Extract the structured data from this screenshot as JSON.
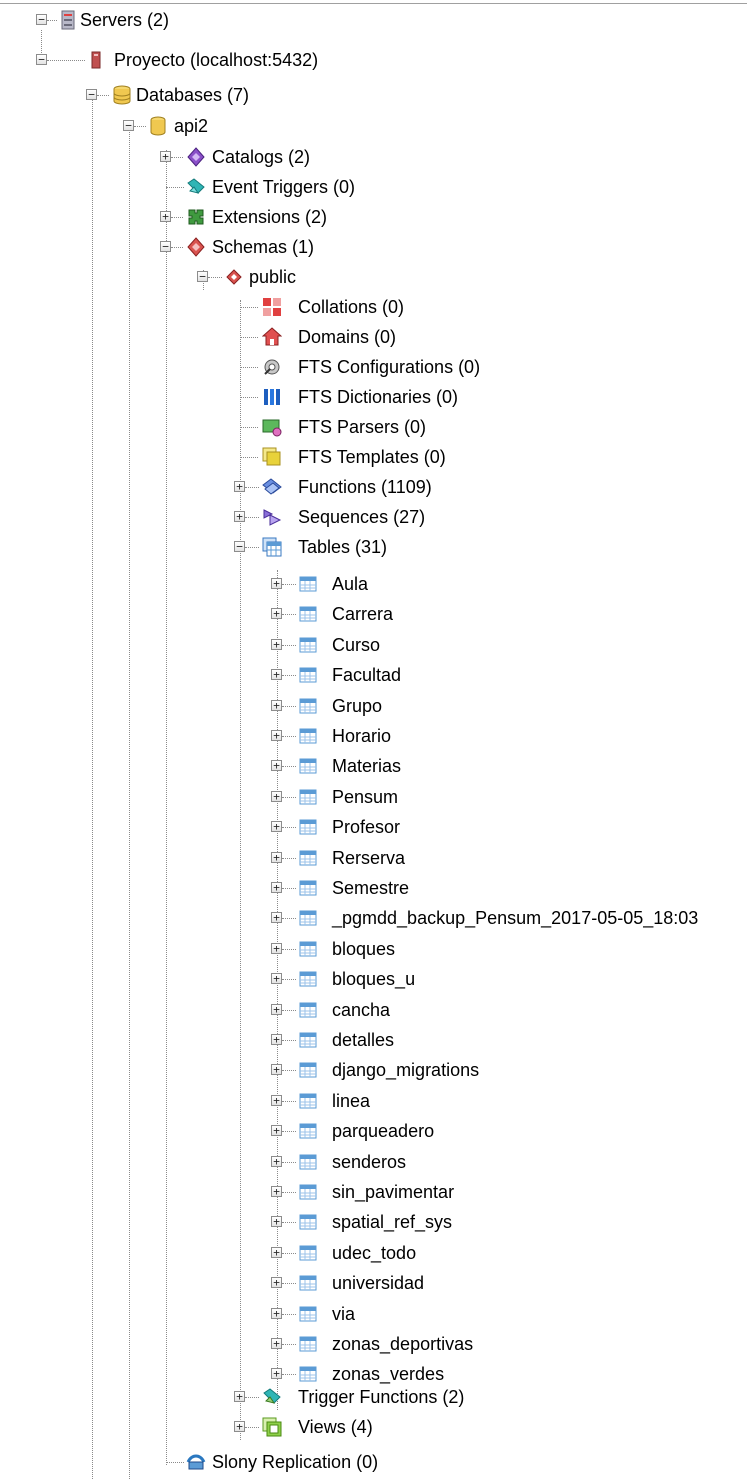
{
  "tree": {
    "servers_label": "Servers (2)",
    "server_label": "Proyecto (localhost:5432)",
    "databases_label": "Databases (7)",
    "database_label": "api2",
    "catalogs_label": "Catalogs (2)",
    "event_triggers_label": "Event Triggers (0)",
    "extensions_label": "Extensions (2)",
    "schemas_label": "Schemas (1)",
    "schema_label": "public",
    "collations_label": "Collations (0)",
    "domains_label": "Domains (0)",
    "fts_configurations_label": "FTS Configurations (0)",
    "fts_dictionaries_label": "FTS Dictionaries (0)",
    "fts_parsers_label": "FTS Parsers (0)",
    "fts_templates_label": "FTS Templates (0)",
    "functions_label": "Functions (1109)",
    "sequences_label": "Sequences (27)",
    "tables_label": "Tables (31)",
    "tables": [
      "Aula",
      "Carrera",
      "Curso",
      "Facultad",
      "Grupo",
      "Horario",
      "Materias",
      "Pensum",
      "Profesor",
      "Rerserva",
      "Semestre",
      "_pgmdd_backup_Pensum_2017-05-05_18:03",
      "bloques",
      "bloques_u",
      "cancha",
      "detalles",
      "django_migrations",
      "linea",
      "parqueadero",
      "senderos",
      "sin_pavimentar",
      "spatial_ref_sys",
      "udec_todo",
      "universidad",
      "via",
      "zonas_deportivas",
      "zonas_verdes"
    ],
    "trigger_functions_label": "Trigger Functions (2)",
    "views_label": "Views (4)",
    "slony_label": "Slony Replication (0)",
    "expander_expanded": "−",
    "expander_collapsed": "+"
  },
  "icons": {
    "servers": "servers-icon",
    "server": "server-icon",
    "databases": "databases-icon",
    "database": "database-icon",
    "catalogs": "catalogs-icon",
    "event_triggers": "event-triggers-icon",
    "extensions": "extensions-icon",
    "schemas": "schemas-icon",
    "schema": "schema-icon",
    "collations": "collations-icon",
    "domains": "domains-icon",
    "fts_configurations": "fts-configurations-icon",
    "fts_dictionaries": "fts-dictionaries-icon",
    "fts_parsers": "fts-parsers-icon",
    "fts_templates": "fts-templates-icon",
    "functions": "functions-icon",
    "sequences": "sequences-icon",
    "tables": "tables-icon",
    "table": "table-icon",
    "trigger_functions": "trigger-functions-icon",
    "views": "views-icon",
    "slony": "slony-replication-icon"
  },
  "colors": {
    "tree_line": "#8a8a8a",
    "table_icon": "#5b9bd5",
    "catalogs": "#8a4fc8",
    "schemas": "#d9534f",
    "extensions": "#3f9a3f",
    "fts_templates": "#e8d23a"
  }
}
